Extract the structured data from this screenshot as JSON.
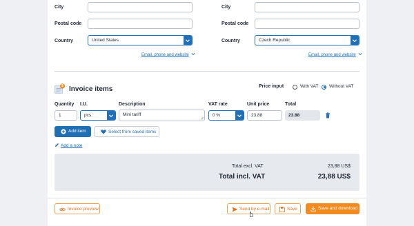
{
  "address": {
    "left": {
      "city_label": "City",
      "city_value": "",
      "postal_label": "Postal code",
      "postal_value": "",
      "country_label": "Country",
      "country_value": "United States",
      "more_link": "Email, phone and website"
    },
    "right": {
      "city_label": "City",
      "city_value": "",
      "postal_label": "Postal code",
      "postal_value": "",
      "country_label": "Country",
      "country_value": "Czech Republic",
      "more_link": "Email, phone and website"
    }
  },
  "invoice_items": {
    "title": "Invoice items",
    "icon_badge": "$",
    "price_input_label": "Price input",
    "with_vat_label": "With VAT",
    "without_vat_label": "Without VAT",
    "price_input_selected": "Without VAT",
    "columns": [
      "Quantity",
      "I.U.",
      "Description",
      "VAT rate",
      "Unit price",
      "Total"
    ],
    "row": {
      "quantity": "1",
      "unit": "pcs.",
      "description": "Mini tariff",
      "vat_rate": "0 %",
      "unit_price": "23,88",
      "total": "23.88"
    },
    "add_item_label": "Add item",
    "select_saved_label": "Select from saved items",
    "add_note_label": "Add a note"
  },
  "totals": {
    "excl_label": "Total excl. VAT",
    "excl_value": "23,88 US$",
    "incl_label": "Total incl. VAT",
    "incl_value": "23,88 US$"
  },
  "footer": {
    "preview_label": "Invoice preview",
    "send_label": "Send by e-mail",
    "save_label": "Save",
    "save_download_label": "Save and download"
  },
  "colors": {
    "primary": "#1f6fb5",
    "accent_orange": "#f28a1d",
    "background": "#eef0f3"
  }
}
